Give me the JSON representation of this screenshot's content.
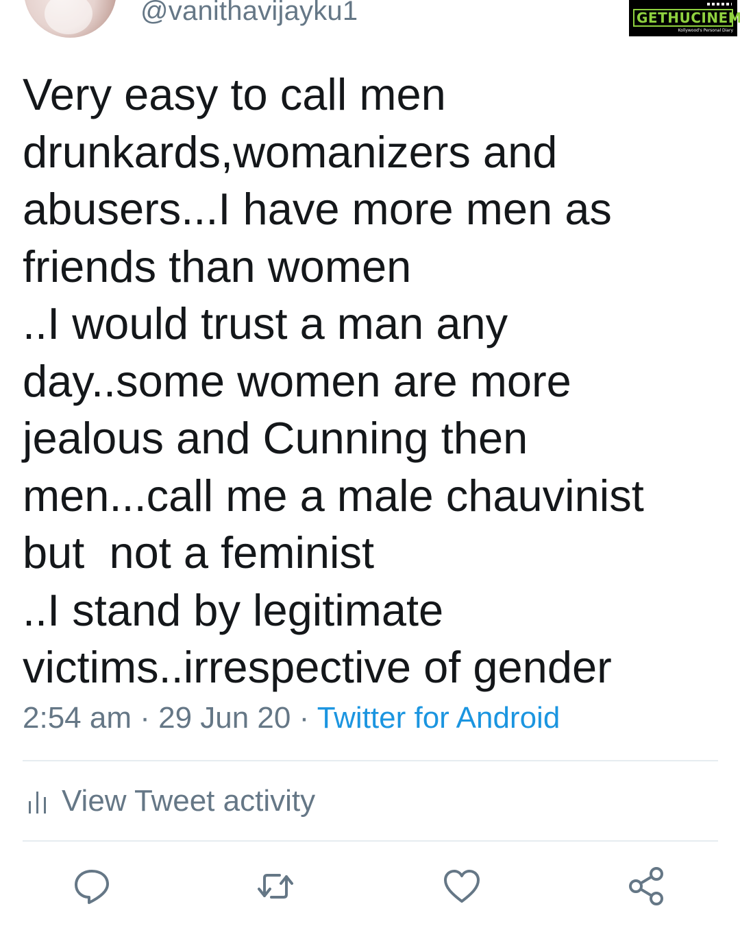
{
  "tweet": {
    "handle": "@vanithavijayku1",
    "text": "Very easy to call men\ndrunkards,womanizers and\nabusers...I have more men as\nfriends than women\n..I would trust a man any\nday..some women are more\njealous and Cunning then\nmen...call me a male chauvinist\nbut  not a feminist\n..I stand by legitimate\nvictims..irrespective of gender",
    "time": "2:54 am",
    "separator": " · ",
    "date": "29 Jun 20",
    "source": "Twitter for Android"
  },
  "activity": {
    "label": "View Tweet activity"
  },
  "actions": {
    "reply": "reply-icon",
    "retweet": "retweet-icon",
    "like": "heart-icon",
    "share": "share-icon"
  },
  "watermark": {
    "text": "GETHUCINEMA",
    "tagline": "Kollywood's Personal Diary"
  },
  "colors": {
    "text": "#14171a",
    "muted": "#657786",
    "link": "#1b95e0",
    "divider": "#e6ecf0",
    "logo_green": "#8fd13f"
  }
}
